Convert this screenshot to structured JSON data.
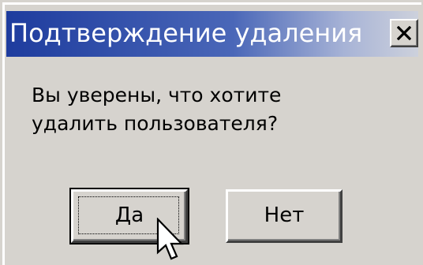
{
  "dialog": {
    "title": "Подтверждение удаления",
    "close_label": "close",
    "message_line1": "Вы уверены, что хотите",
    "message_line2": "удалить пользователя?",
    "buttons": {
      "yes_label": "Да",
      "no_label": "Нет"
    }
  },
  "colors": {
    "titlebar_start": "#1e3c9e",
    "titlebar_end": "#cdd1dc",
    "face": "#d6d3ce"
  },
  "icons": {
    "close": "close-icon",
    "cursor": "mouse-pointer-icon"
  }
}
